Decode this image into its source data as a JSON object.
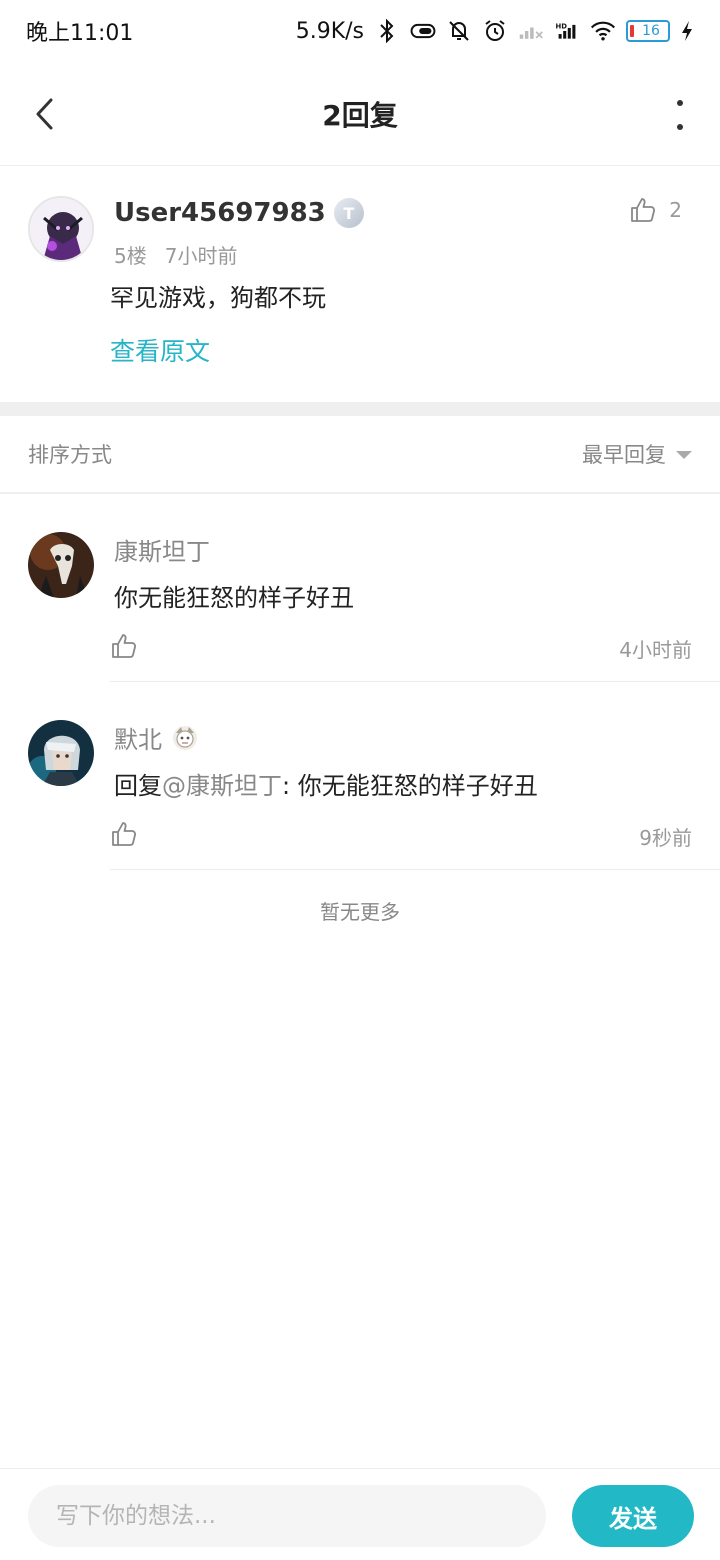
{
  "status_bar": {
    "time": "晚上11:01",
    "network_speed": "5.9K/s",
    "battery_level": "16",
    "icons": [
      "bluetooth-icon",
      "toggle-icon",
      "mute-bell-icon",
      "alarm-icon",
      "signal-weak-icon",
      "signal-hd-icon",
      "wifi-icon",
      "battery-icon",
      "charging-icon"
    ]
  },
  "header": {
    "title": "2回复"
  },
  "post": {
    "username": "User45697983",
    "level_badge": "T",
    "floor": "5楼",
    "time": "7小时前",
    "content": "罕见游戏，狗都不玩",
    "view_original": "查看原文",
    "like_count": "2"
  },
  "sort": {
    "label": "排序方式",
    "selected": "最早回复"
  },
  "replies": [
    {
      "username": "康斯坦丁",
      "content": "你无能狂怒的样子好丑",
      "time": "4小时前"
    },
    {
      "username": "默北",
      "reply_prefix": "回复",
      "mention": "@康斯坦丁",
      "content_suffix": ": 你无能狂怒的样子好丑",
      "time": "9秒前"
    }
  ],
  "no_more": "暂无更多",
  "composer": {
    "placeholder": "写下你的想法...",
    "send_label": "发送"
  },
  "colors": {
    "accent": "#22b8c6",
    "link": "#26b5c7"
  }
}
